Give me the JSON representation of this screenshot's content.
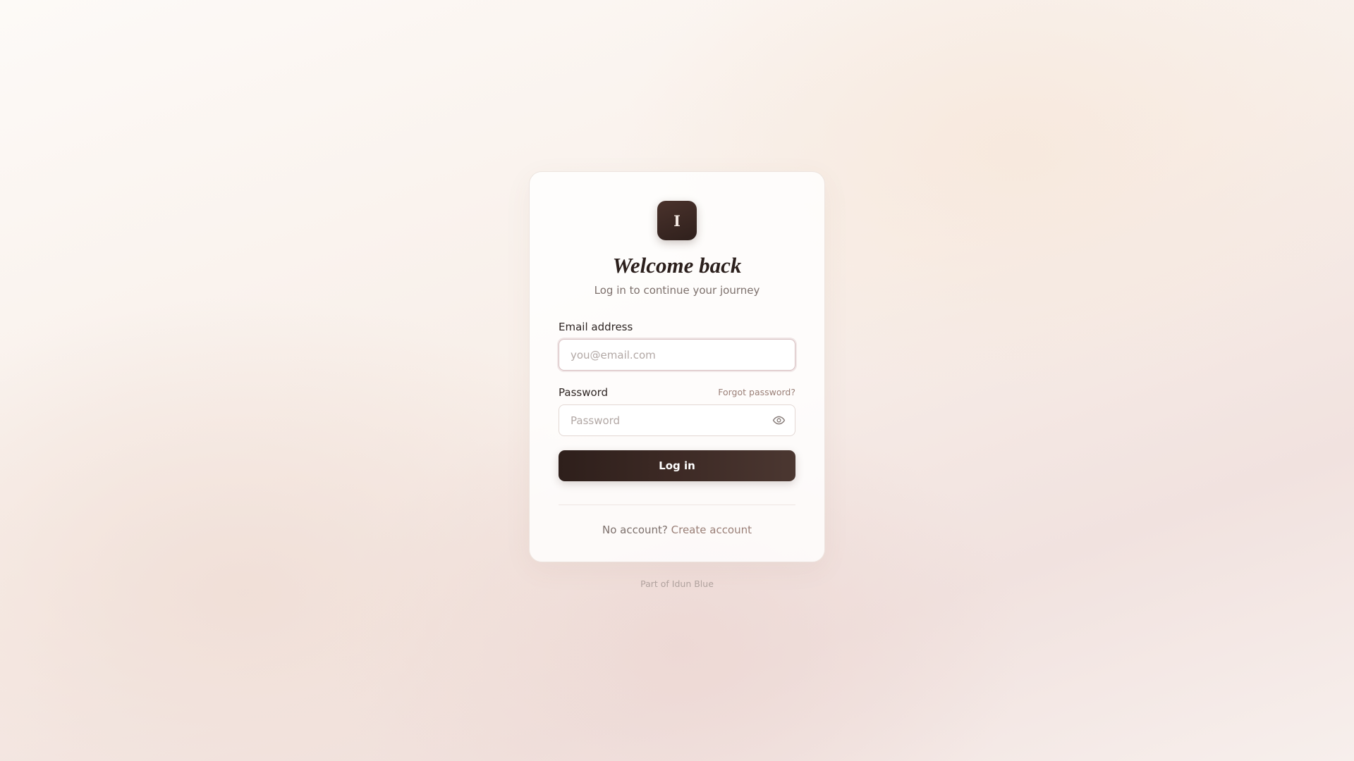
{
  "card": {
    "logo_letter": "I",
    "title": "Welcome back",
    "subtitle": "Log in to continue your journey"
  },
  "form": {
    "email": {
      "label": "Email address",
      "placeholder": "you@email.com",
      "value": ""
    },
    "password": {
      "label": "Password",
      "placeholder": "Password",
      "value": "",
      "forgot_label": "Forgot password?",
      "toggle_icon": "eye-icon"
    },
    "submit_label": "Log in"
  },
  "signup": {
    "prompt": "No account?",
    "link_label": "Create account"
  },
  "brand_note": "Part of Idun Blue",
  "colors": {
    "accent_dark": "#2e1f1b",
    "link": "#9a7f77"
  }
}
